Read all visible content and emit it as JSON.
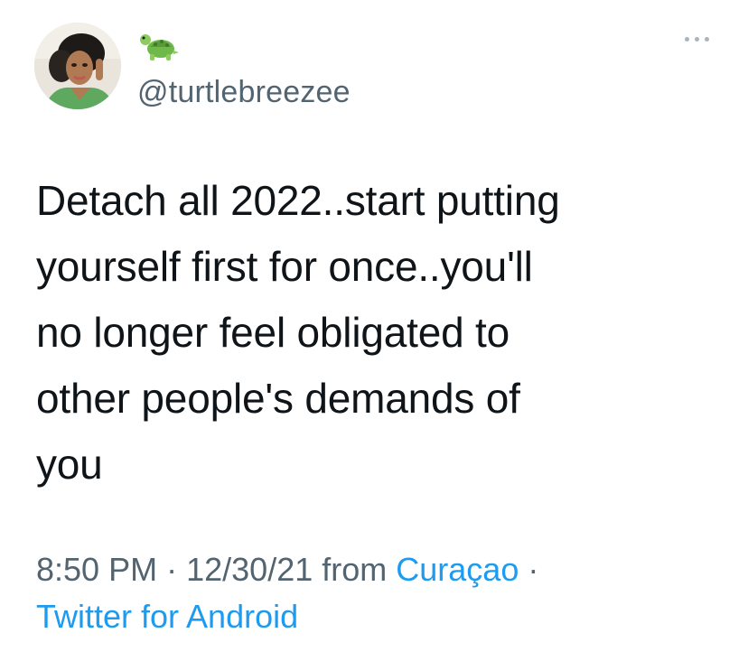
{
  "author": {
    "handle": "@turtlebreezee",
    "name_emoji": "turtle-emoji",
    "avatar": "profile-photo"
  },
  "tweet": {
    "lines": [
      "Detach all 2022..start putting",
      "yourself first for once..you'll",
      "no longer feel obligated to",
      "other people's demands of",
      "you"
    ]
  },
  "meta": {
    "time": "8:50 PM",
    "separator": "·",
    "date": "12/30/21",
    "from_label": "from",
    "location": "Curaçao",
    "separator2": "·",
    "source": "Twitter for Android"
  },
  "more_icon": "more-options-icon",
  "colors": {
    "text": "#0f1419",
    "secondary": "#536471",
    "link": "#1d9bf0"
  }
}
